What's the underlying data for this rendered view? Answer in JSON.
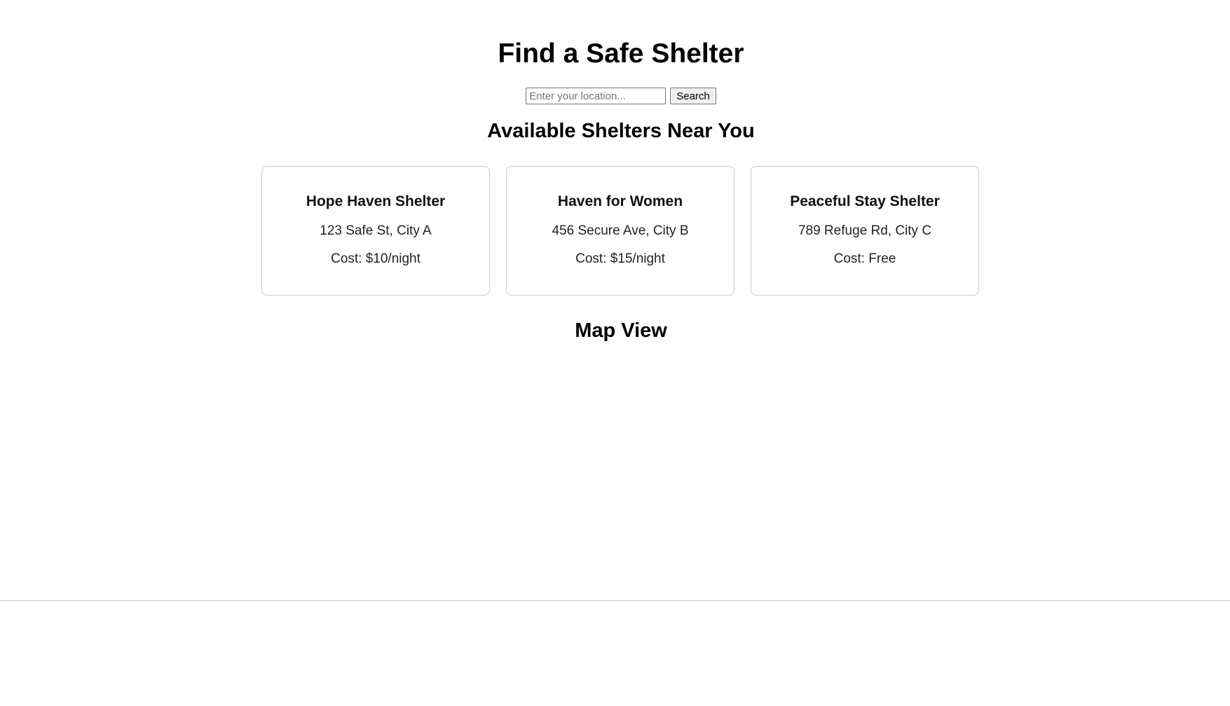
{
  "header": {
    "title": "Find a Safe Shelter"
  },
  "search": {
    "placeholder": "Enter your location...",
    "value": "",
    "button_label": "Search"
  },
  "shelters": {
    "heading": "Available Shelters Near You",
    "items": [
      {
        "name": "Hope Haven Shelter",
        "address": "123 Safe St, City A",
        "cost": "Cost: $10/night"
      },
      {
        "name": "Haven for Women",
        "address": "456 Secure Ave, City B",
        "cost": "Cost: $15/night"
      },
      {
        "name": "Peaceful Stay Shelter",
        "address": "789 Refuge Rd, City C",
        "cost": "Cost: Free"
      }
    ]
  },
  "map": {
    "heading": "Map View"
  },
  "colors": {
    "background": "#ffffff",
    "card_border": "#cccccc",
    "text": "#111111"
  }
}
